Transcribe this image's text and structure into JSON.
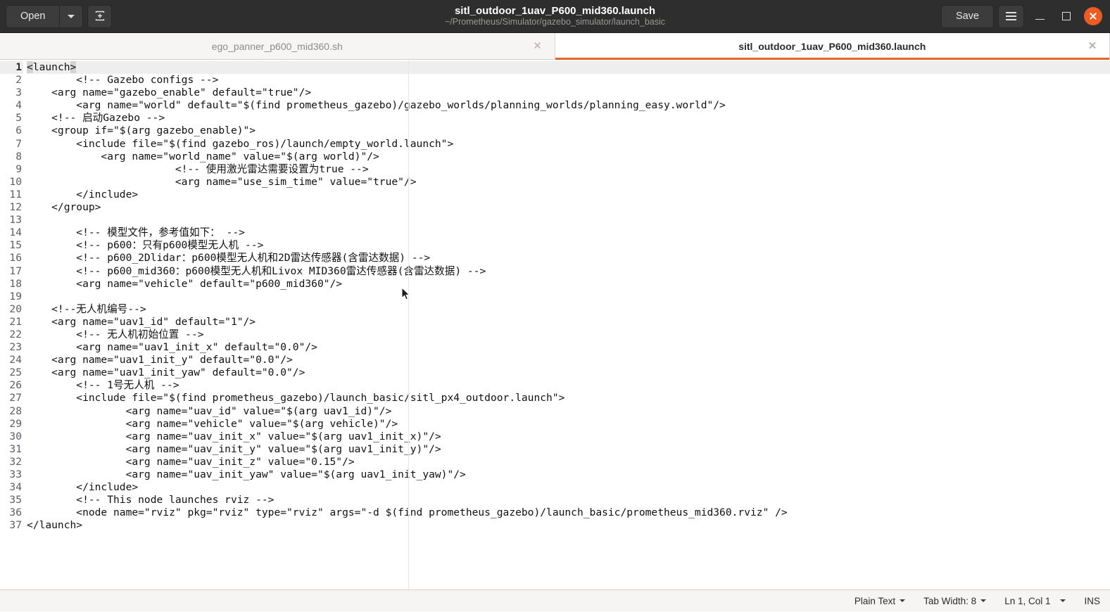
{
  "window": {
    "title": "sitl_outdoor_1uav_P600_mid360.launch",
    "subtitle": "~/Prometheus/Simulator/gazebo_simulator/launch_basic",
    "accent_color": "#e8622b",
    "close_button_color": "#ec5c23",
    "titlebar_color": "#2e2e2e"
  },
  "toolbar": {
    "open_label": "Open",
    "open_dropdown_icon": "chevron-down-icon",
    "new_tab_icon": "new-document-icon",
    "save_label": "Save",
    "menu_icon": "hamburger-menu-icon",
    "minimize_icon": "minimize-icon",
    "maximize_icon": "maximize-icon",
    "close_icon": "close-icon"
  },
  "tabs": [
    {
      "label": "ego_panner_p600_mid360.sh",
      "active": false,
      "close_icon": "close-icon"
    },
    {
      "label": "sitl_outdoor_1uav_P600_mid360.launch",
      "active": true,
      "close_icon": "close-icon"
    }
  ],
  "editor": {
    "current_line": 1,
    "total_lines": 37,
    "line_numbers": [
      "1",
      "2",
      "3",
      "4",
      "5",
      "6",
      "7",
      "8",
      "9",
      "10",
      "11",
      "12",
      "13",
      "14",
      "15",
      "16",
      "17",
      "18",
      "19",
      "20",
      "21",
      "22",
      "23",
      "24",
      "25",
      "26",
      "27",
      "28",
      "29",
      "30",
      "31",
      "32",
      "33",
      "34",
      "35",
      "36",
      "37"
    ],
    "lines": [
      "<launch>",
      "        <!-- Gazebo configs -->",
      "    <arg name=\"gazebo_enable\" default=\"true\"/>",
      "        <arg name=\"world\" default=\"$(find prometheus_gazebo)/gazebo_worlds/planning_worlds/planning_easy.world\"/>",
      "    <!-- 启动Gazebo -->",
      "    <group if=\"$(arg gazebo_enable)\">",
      "        <include file=\"$(find gazebo_ros)/launch/empty_world.launch\">",
      "            <arg name=\"world_name\" value=\"$(arg world)\"/>",
      "                        <!-- 使用激光雷达需要设置为true -->",
      "                        <arg name=\"use_sim_time\" value=\"true\"/>",
      "        </include>",
      "    </group>",
      "",
      "        <!-- 模型文件，参考值如下： -->",
      "        <!-- p600：只有p600模型无人机 -->",
      "        <!-- p600_2Dlidar：p600模型无人机和2D雷达传感器(含雷达数据) -->",
      "        <!-- p600_mid360：p600模型无人机和Livox MID360雷达传感器(含雷达数据) -->",
      "        <arg name=\"vehicle\" default=\"p600_mid360\"/>",
      "",
      "    <!--无人机编号-->",
      "    <arg name=\"uav1_id\" default=\"1\"/>",
      "        <!-- 无人机初始位置 -->",
      "        <arg name=\"uav1_init_x\" default=\"0.0\"/>",
      "    <arg name=\"uav1_init_y\" default=\"0.0\"/>",
      "    <arg name=\"uav1_init_yaw\" default=\"0.0\"/>",
      "        <!-- 1号无人机 -->",
      "        <include file=\"$(find prometheus_gazebo)/launch_basic/sitl_px4_outdoor.launch\">",
      "                <arg name=\"uav_id\" value=\"$(arg uav1_id)\"/>",
      "                <arg name=\"vehicle\" value=\"$(arg vehicle)\"/>",
      "                <arg name=\"uav_init_x\" value=\"$(arg uav1_init_x)\"/>",
      "                <arg name=\"uav_init_y\" value=\"$(arg uav1_init_y)\"/>",
      "                <arg name=\"uav_init_z\" value=\"0.15\"/>",
      "                <arg name=\"uav_init_yaw\" value=\"$(arg uav1_init_yaw)\"/>",
      "        </include>",
      "        <!-- This node launches rviz -->",
      "        <node name=\"rviz\" pkg=\"rviz\" type=\"rviz\" args=\"-d $(find prometheus_gazebo)/launch_basic/prometheus_mid360.rviz\" />",
      "</launch>"
    ]
  },
  "statusbar": {
    "language": "Plain Text",
    "tab_width": "Tab Width: 8",
    "position": "Ln 1, Col 1",
    "insert_mode": "INS"
  }
}
